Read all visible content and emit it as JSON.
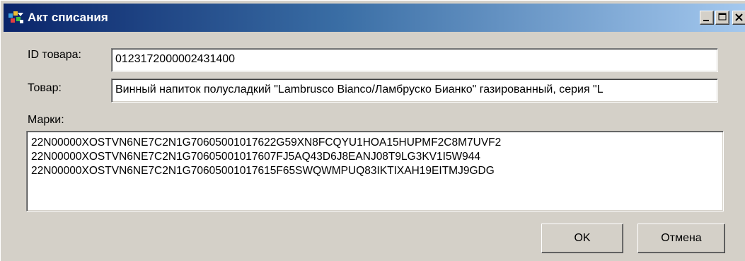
{
  "window": {
    "title": "Акт списания",
    "controls": {
      "minimize": "minimize-icon",
      "maximize": "maximize-icon",
      "close": "close-icon"
    }
  },
  "form": {
    "id_label": "ID товара:",
    "id_value": "0123172000002431400",
    "product_label": "Товар:",
    "product_value": "Винный напиток полусладкий \"Lambrusco Bianco/Ламбруско Бианко\" газированный, серия \"L",
    "marks_label": "Марки:",
    "marks": [
      "22N00000XOSTVN6NE7C2N1G70605001017622G59XN8FCQYU1HOA15HUPMF2C8M7UVF2",
      "22N00000XOSTVN6NE7C2N1G70605001017607FJ5AQ43D6J8EANJ08T9LG3KV1I5W944",
      "22N00000XOSTVN6NE7C2N1G70605001017615F65SWQWMPUQ83IKTIXAH19EITMJ9GDG"
    ]
  },
  "buttons": {
    "ok": "OK",
    "cancel": "Отмена"
  },
  "colors": {
    "titlebar_start": "#0a246a",
    "titlebar_end": "#a6caf0",
    "window_face": "#d4d0c8"
  }
}
